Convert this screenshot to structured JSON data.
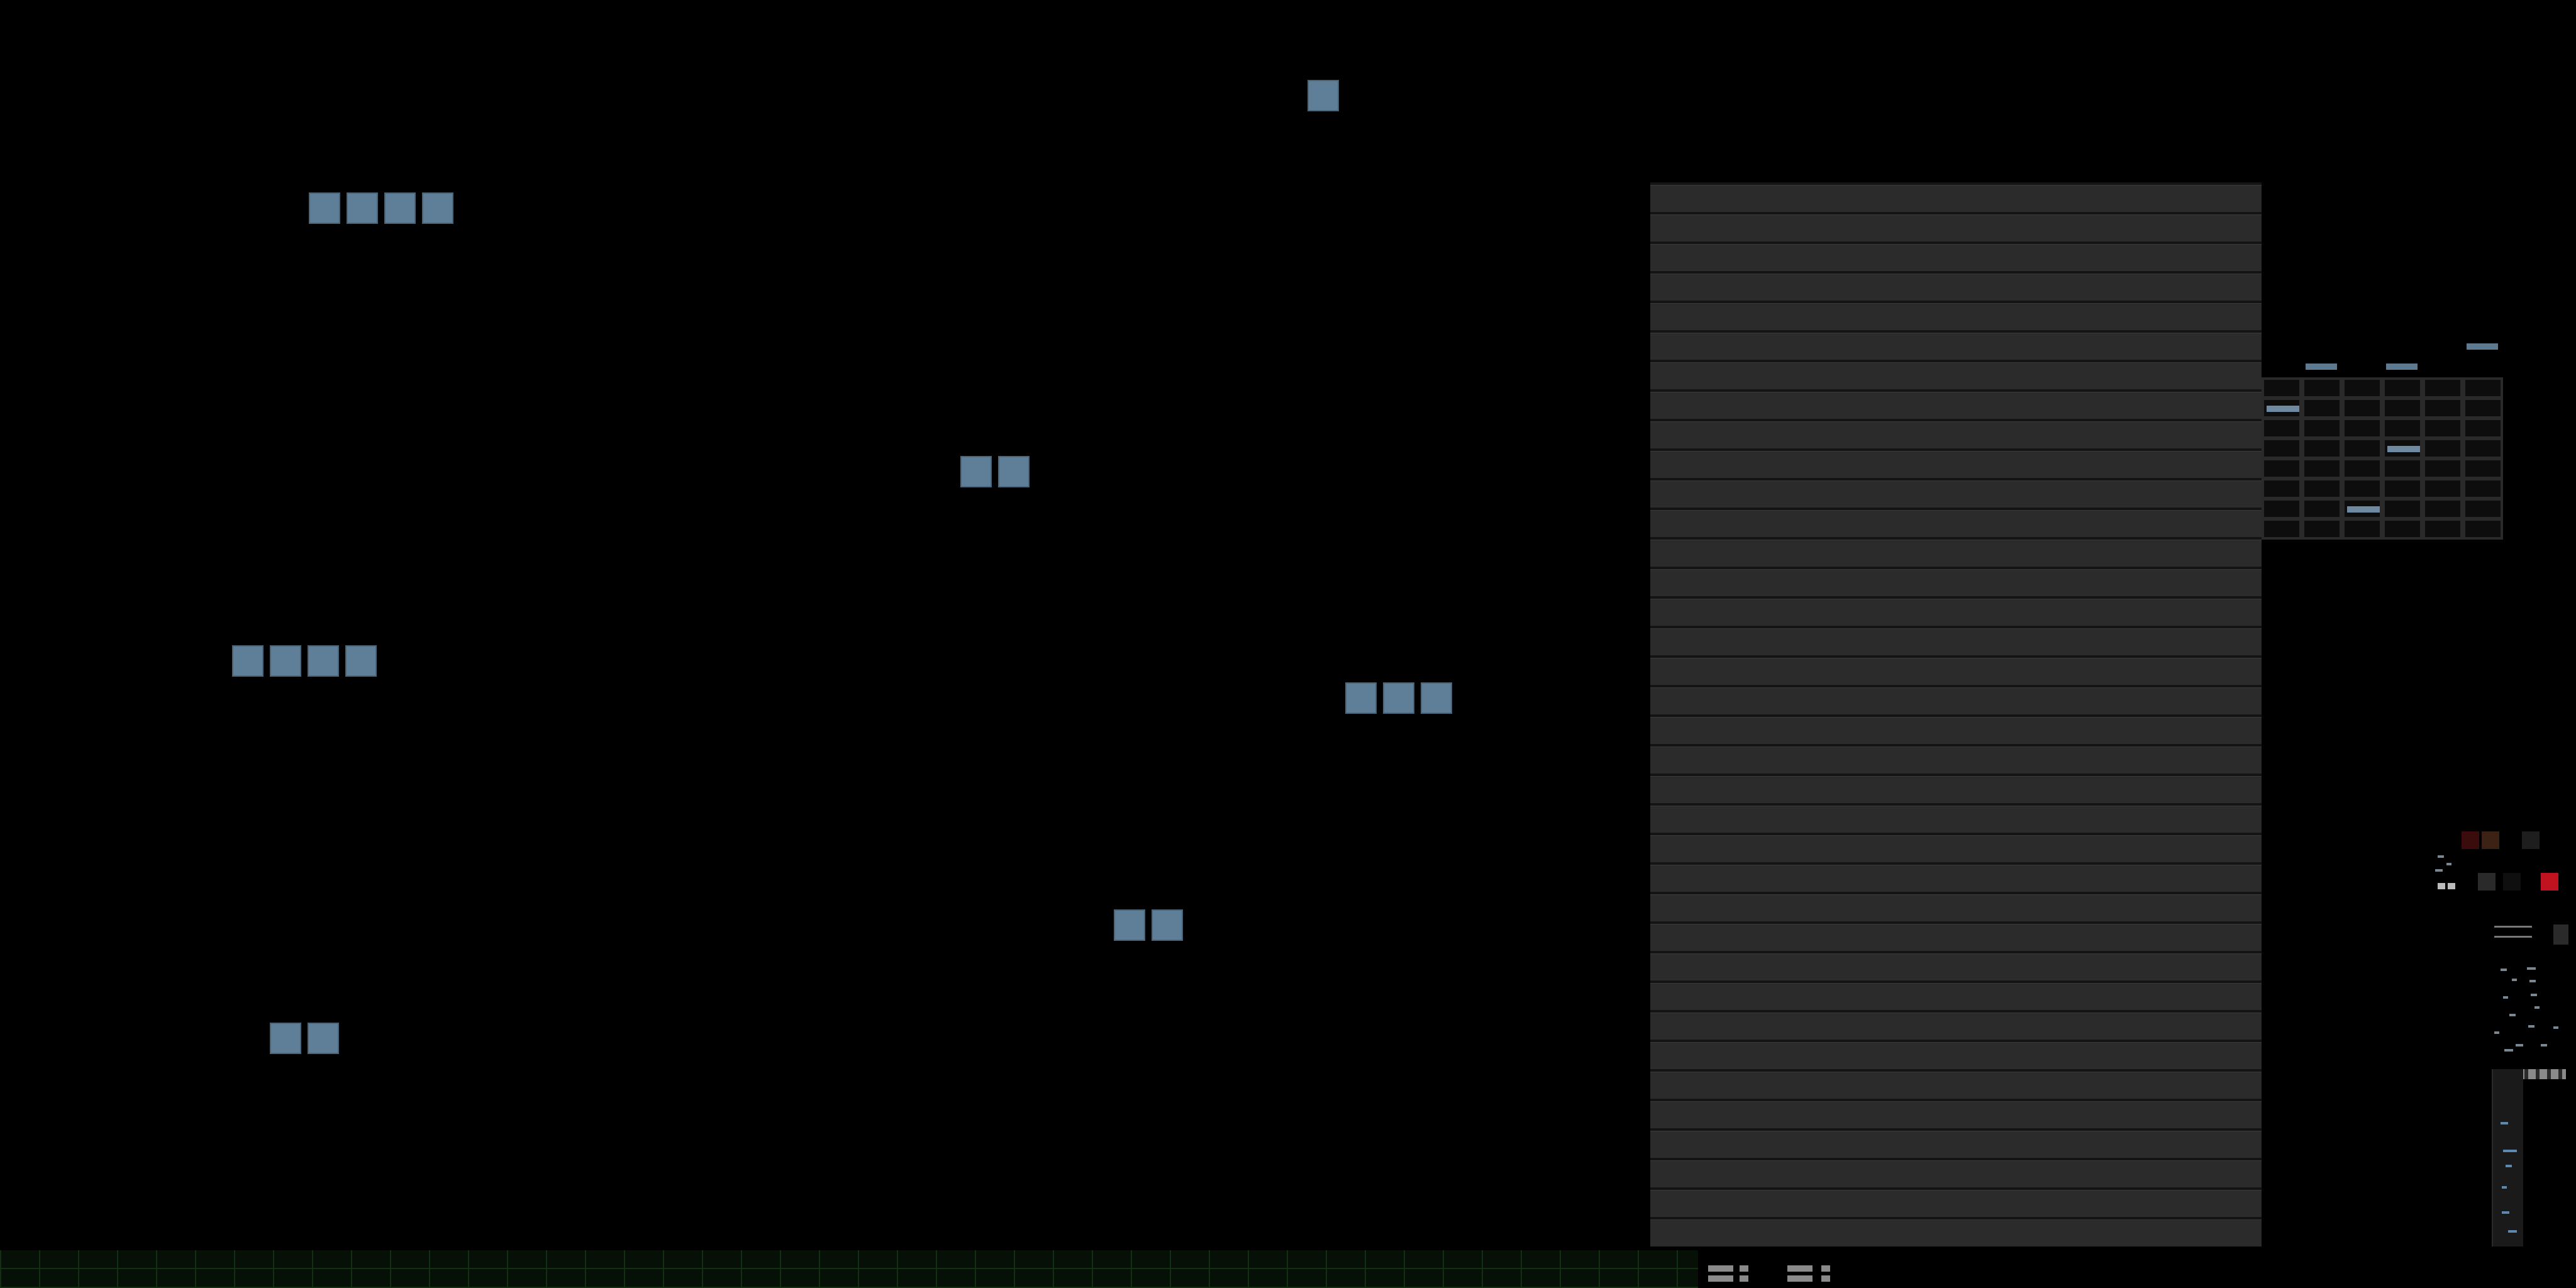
{
  "window": {
    "title": ""
  },
  "canvas": {
    "block_color": "#5f7f98",
    "block_groups": [
      {
        "name": "group-1",
        "count": 1
      },
      {
        "name": "group-2",
        "count": 4
      },
      {
        "name": "group-3",
        "count": 2
      },
      {
        "name": "group-4",
        "count": 4
      },
      {
        "name": "group-5",
        "count": 3
      },
      {
        "name": "group-6",
        "count": 2
      },
      {
        "name": "group-7",
        "count": 2
      }
    ]
  },
  "track_panel": {
    "row_count": 36,
    "row_color": "#2b2b2b"
  },
  "mini_grid": {
    "rows": 8,
    "cols": 6,
    "accent": "#6f8aa0"
  },
  "tool_cluster": {
    "accent_red": "#c1121f",
    "dark_red": "#3a0c0c",
    "brown": "#3b2214"
  },
  "mixer": {
    "accent": "#5d89b0"
  },
  "bottom_strip": {
    "color": "#143014"
  },
  "icons": [
    "block-icon",
    "grid-icon",
    "mixer-icon",
    "toolbar-icon"
  ]
}
